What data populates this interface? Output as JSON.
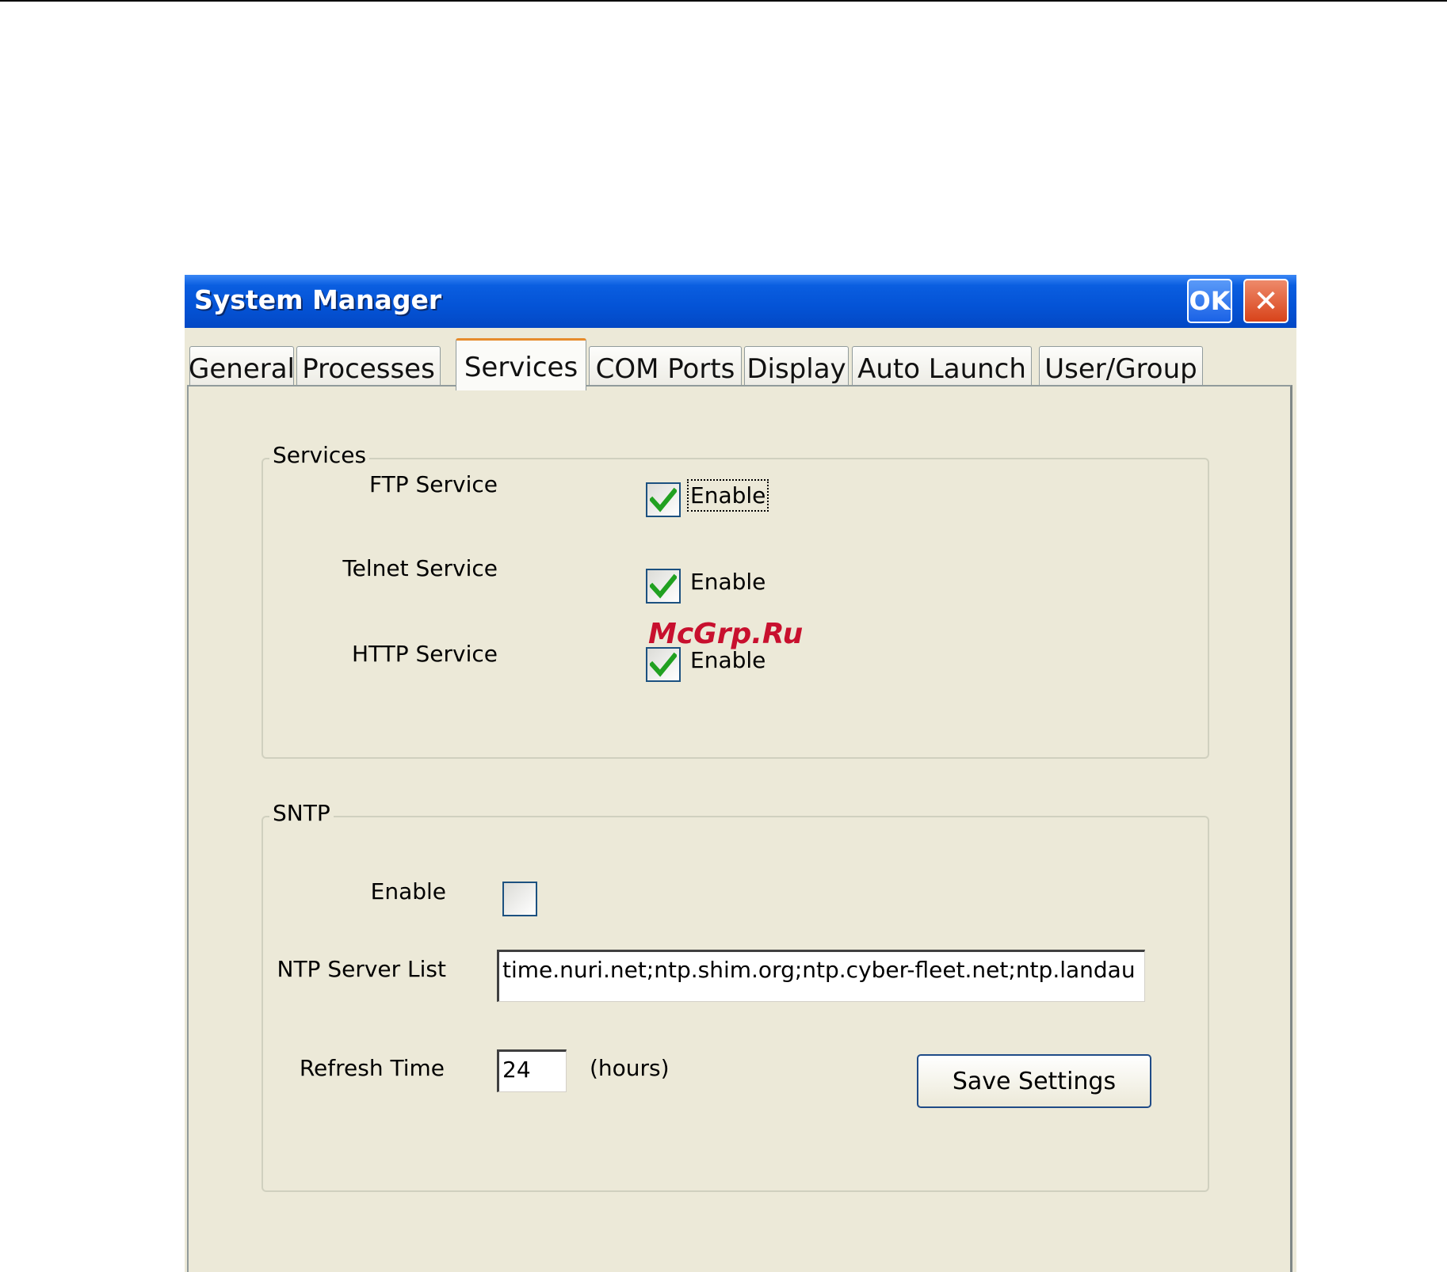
{
  "window": {
    "title": "System Manager",
    "ok_label": "OK",
    "close_glyph": "✕"
  },
  "tabs": [
    {
      "label": "General",
      "active": false
    },
    {
      "label": "Processes",
      "active": false
    },
    {
      "label": "Services",
      "active": true
    },
    {
      "label": "COM Ports",
      "active": false
    },
    {
      "label": "Display",
      "active": false
    },
    {
      "label": "Auto Launch",
      "active": false
    },
    {
      "label": "User/Group",
      "active": false
    }
  ],
  "services_group": {
    "title": "Services",
    "items": [
      {
        "label": "FTP Service",
        "checkbox_label": "Enable",
        "checked": true
      },
      {
        "label": "Telnet Service",
        "checkbox_label": "Enable",
        "checked": true
      },
      {
        "label": "HTTP Service",
        "checkbox_label": "Enable",
        "checked": true
      }
    ]
  },
  "sntp_group": {
    "title": "SNTP",
    "enable_label": "Enable",
    "enable_checked": false,
    "ntp_label": "NTP Server List",
    "ntp_value": "time.nuri.net;ntp.shim.org;ntp.cyber-fleet.net;ntp.landau",
    "refresh_label": "Refresh Time",
    "refresh_value": "24",
    "refresh_unit": "(hours)",
    "save_label": "Save Settings"
  },
  "watermark": "McGrp.Ru",
  "colors": {
    "titlebar": "#0453d6",
    "dialog_bg": "#ece9d8",
    "check_green": "#21a121",
    "active_tab_accent": "#e68b2c",
    "watermark": "#c8102e"
  },
  "icons": {
    "checkmark": "checkmark-icon",
    "close": "close-icon"
  }
}
